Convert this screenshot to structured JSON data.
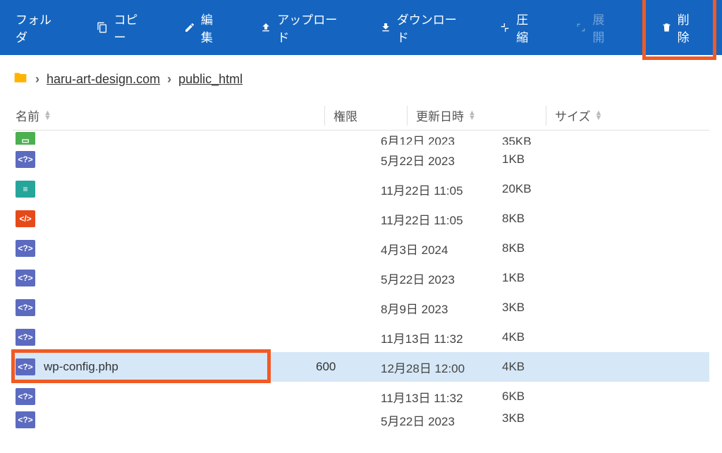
{
  "toolbar": {
    "folder": "フォルダ",
    "copy": "コピー",
    "edit": "編集",
    "upload": "アップロード",
    "download": "ダウンロード",
    "compress": "圧縮",
    "expand": "展開",
    "delete": "削除"
  },
  "breadcrumb": {
    "domain": "haru-art-design.com",
    "folder": "public_html"
  },
  "columns": {
    "name": "名前",
    "perm": "権限",
    "date": "更新日時",
    "size": "サイズ"
  },
  "rows": [
    {
      "icon": "img",
      "name": "",
      "perm": "",
      "date": "6月12日 2023",
      "size": "35KB",
      "cut": "top"
    },
    {
      "icon": "php",
      "name": "",
      "perm": "",
      "date": "5月22日 2023",
      "size": "1KB"
    },
    {
      "icon": "txt",
      "name": "",
      "perm": "",
      "date": "11月22日 11:05",
      "size": "20KB"
    },
    {
      "icon": "html",
      "name": "",
      "perm": "",
      "date": "11月22日 11:05",
      "size": "8KB"
    },
    {
      "icon": "php",
      "name": "",
      "perm": "",
      "date": "4月3日 2024",
      "size": "8KB"
    },
    {
      "icon": "php",
      "name": "",
      "perm": "",
      "date": "5月22日 2023",
      "size": "1KB"
    },
    {
      "icon": "php",
      "name": "",
      "perm": "",
      "date": "8月9日 2023",
      "size": "3KB"
    },
    {
      "icon": "php",
      "name": "",
      "perm": "",
      "date": "11月13日 11:32",
      "size": "4KB"
    },
    {
      "icon": "php",
      "name": "wp-config.php",
      "perm": "600",
      "date": "12月28日 12:00",
      "size": "4KB",
      "selected": true,
      "highlighted": true
    },
    {
      "icon": "php",
      "name": "",
      "perm": "",
      "date": "11月13日 11:32",
      "size": "6KB"
    },
    {
      "icon": "php",
      "name": "",
      "perm": "",
      "date": "5月22日 2023",
      "size": "3KB",
      "cut": "bot"
    }
  ]
}
